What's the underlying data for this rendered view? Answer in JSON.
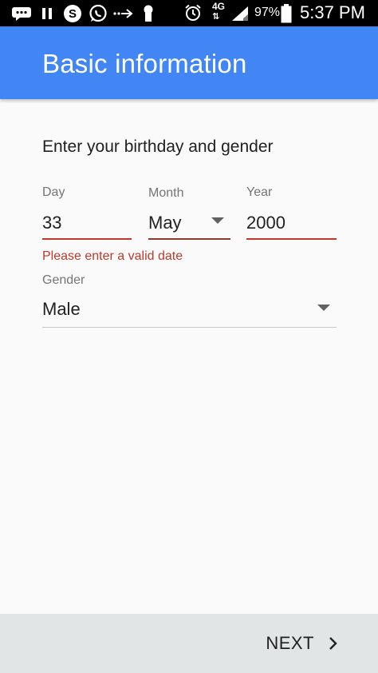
{
  "status_bar": {
    "icons": [
      "messages-icon",
      "pause-icon",
      "skype-icon",
      "whatsapp-icon",
      "transfer-icon",
      "keyhole-icon",
      "alarm-icon",
      "signal-icon"
    ],
    "network": "4G",
    "battery_percent": "97%",
    "time": "5:37 PM"
  },
  "app_bar": {
    "title": "Basic information"
  },
  "form": {
    "heading": "Enter your birthday and gender",
    "day": {
      "label": "Day",
      "value": "33"
    },
    "month": {
      "label": "Month",
      "value": "May"
    },
    "year": {
      "label": "Year",
      "value": "2000"
    },
    "error": "Please enter a valid date",
    "gender": {
      "label": "Gender",
      "value": "Male"
    }
  },
  "footer": {
    "next_label": "NEXT"
  },
  "colors": {
    "app_bar": "#4285f4",
    "error": "#c0392b",
    "background": "#fafafa",
    "footer": "#e2e5e6"
  }
}
